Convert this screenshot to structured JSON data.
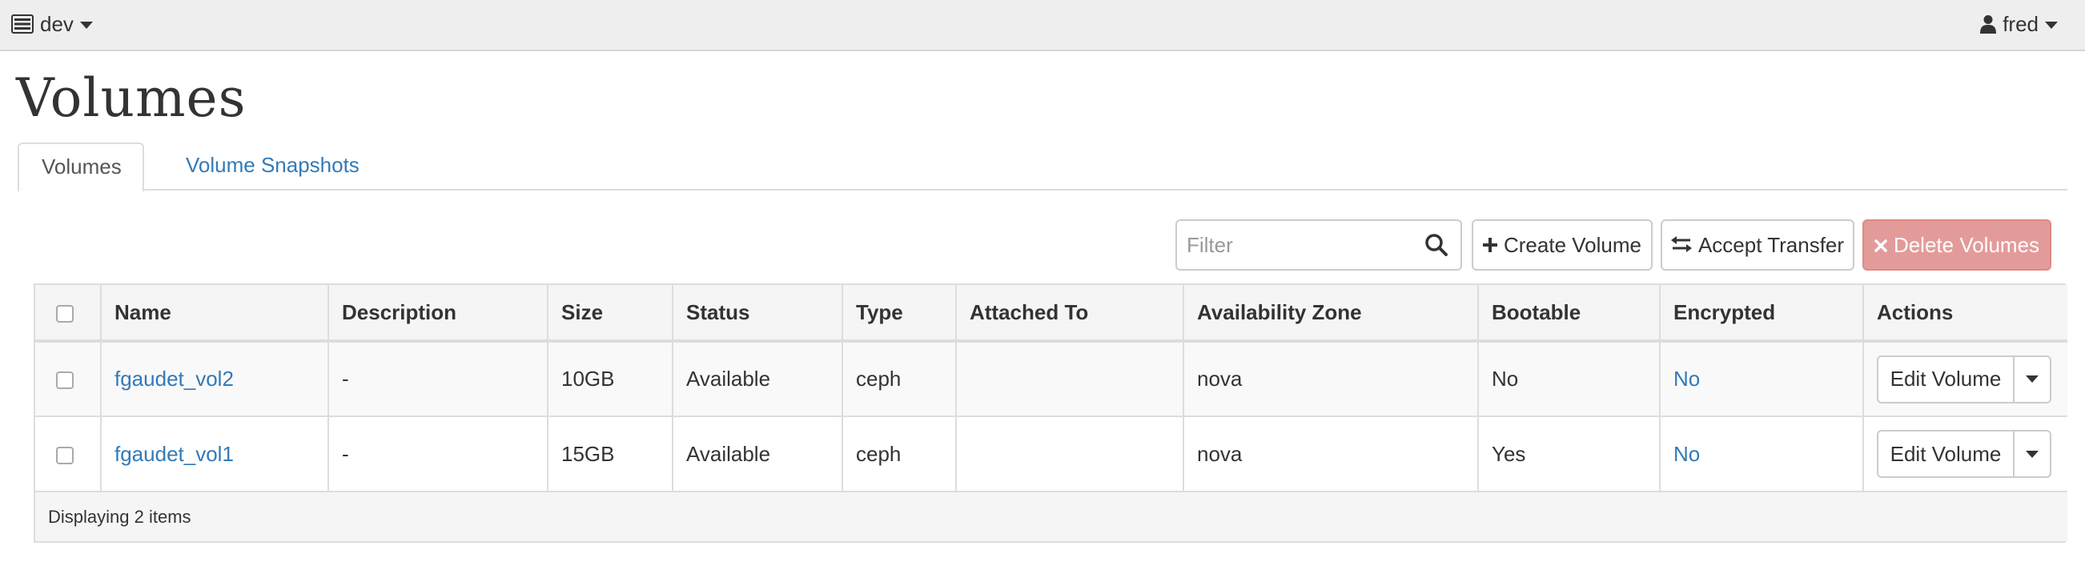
{
  "navbar": {
    "project_label": "dev",
    "user_label": "fred",
    "project_icon": "server-icon",
    "user_icon": "user-icon"
  },
  "page": {
    "title": "Volumes"
  },
  "tabs": [
    {
      "label": "Volumes",
      "active": true
    },
    {
      "label": "Volume Snapshots",
      "active": false
    }
  ],
  "toolbar": {
    "filter_placeholder": "Filter",
    "filter_value": "",
    "create_label": "Create Volume",
    "accept_label": "Accept Transfer",
    "delete_label": "Delete Volumes",
    "delete_color": "#e39b99"
  },
  "table": {
    "columns": [
      "Name",
      "Description",
      "Size",
      "Status",
      "Type",
      "Attached To",
      "Availability Zone",
      "Bootable",
      "Encrypted",
      "Actions"
    ],
    "rows": [
      {
        "name": "fgaudet_vol2",
        "description": "-",
        "size": "10GB",
        "status": "Available",
        "type": "ceph",
        "attached_to": "",
        "availability_zone": "nova",
        "bootable": "No",
        "encrypted": "No",
        "action": "Edit Volume"
      },
      {
        "name": "fgaudet_vol1",
        "description": "-",
        "size": "15GB",
        "status": "Available",
        "type": "ceph",
        "attached_to": "",
        "availability_zone": "nova",
        "bootable": "Yes",
        "encrypted": "No",
        "action": "Edit Volume"
      }
    ],
    "footer": "Displaying 2 items"
  },
  "colors": {
    "link": "#337ab7",
    "navbar_bg": "#eeeeee",
    "header_bg": "#f5f5f5"
  }
}
